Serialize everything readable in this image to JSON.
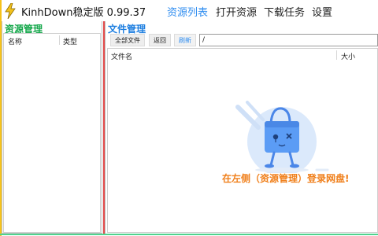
{
  "app": {
    "title": "KinhDown稳定版 0.99.37"
  },
  "nav": {
    "items": [
      {
        "label": "资源列表",
        "active": true
      },
      {
        "label": "打开资源",
        "active": false
      },
      {
        "label": "下载任务",
        "active": false
      },
      {
        "label": "设置",
        "active": false
      }
    ]
  },
  "left_panel": {
    "title": "资源管理",
    "columns": [
      "名称",
      "类型"
    ]
  },
  "right_panel": {
    "title": "文件管理",
    "toolbar": {
      "all_files": "全部文件",
      "back": "返回",
      "refresh": "刷新"
    },
    "path_value": "/",
    "columns": [
      "文件名",
      "大小"
    ],
    "empty_hint": "在左侧（资源管理）登录网盘!"
  },
  "colors": {
    "accent_blue": "#2f8df0",
    "green": "#16a84c",
    "orange": "#f07f1a",
    "mascot_blue": "#5b9cf5",
    "mascot_bg": "#dbe9fb"
  },
  "icons": {
    "app": "lightning-bolt-icon",
    "empty_state": "bag-mascot-illustration"
  }
}
